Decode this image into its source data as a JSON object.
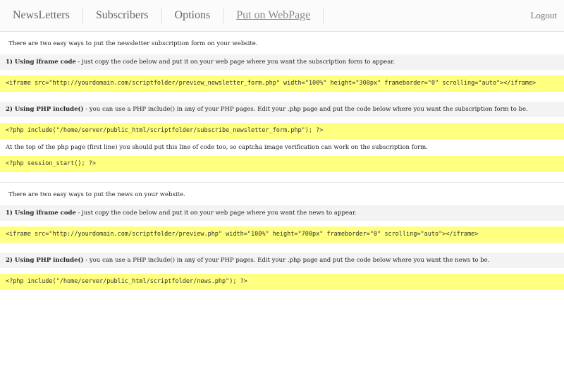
{
  "nav": {
    "items": [
      "NewsLetters",
      "Subscribers",
      "Options",
      "Put on WebPage"
    ],
    "logout": "Logout"
  },
  "newsletter": {
    "intro": "There are two easy ways to put the newsletter subscription form on your website.",
    "iframe_title": "1) Using iframe code",
    "iframe_desc": " - just copy the code below and put it on your web page where you want the subscription form to appear.",
    "iframe_code": "<iframe src=\"http://yourdomain.com/scriptfolder/preview_newsletter_form.php\" width=\"100%\" height=\"300px\" frameborder=\"0\" scrolling=\"auto\"></iframe>",
    "php_title": "2) Using PHP include()",
    "php_desc": " - you can use a PHP include() in any of your PHP pages. Edit your .php page and put the code below where you want the subscription form to be.",
    "php_code": "<?php include(\"/home/server/public_html/scriptfolder/subscribe_newsletter_form.php\"); ?>",
    "session_note": "At the top of the php page (first line) you should put this line of code too, so captcha image verification can work on the subscription form.",
    "session_code": "<?php session_start(); ?>"
  },
  "news": {
    "intro": "There are two easy ways to put the news on your website.",
    "iframe_title": "1) Using iframe code",
    "iframe_desc": " - just copy the code below and put it on your web page where you want the news to appear.",
    "iframe_code": "<iframe src=\"http://yourdomain.com/scriptfolder/preview.php\" width=\"100%\" height=\"700px\" frameborder=\"0\" scrolling=\"auto\"></iframe>",
    "php_title": "2) Using PHP include()",
    "php_desc": " - you can use a PHP include() in any of your PHP pages. Edit your .php page and put the code below where you want the news to be.",
    "php_code": "<?php include(\"/home/server/public_html/scriptfolder/news.php\"); ?>"
  }
}
